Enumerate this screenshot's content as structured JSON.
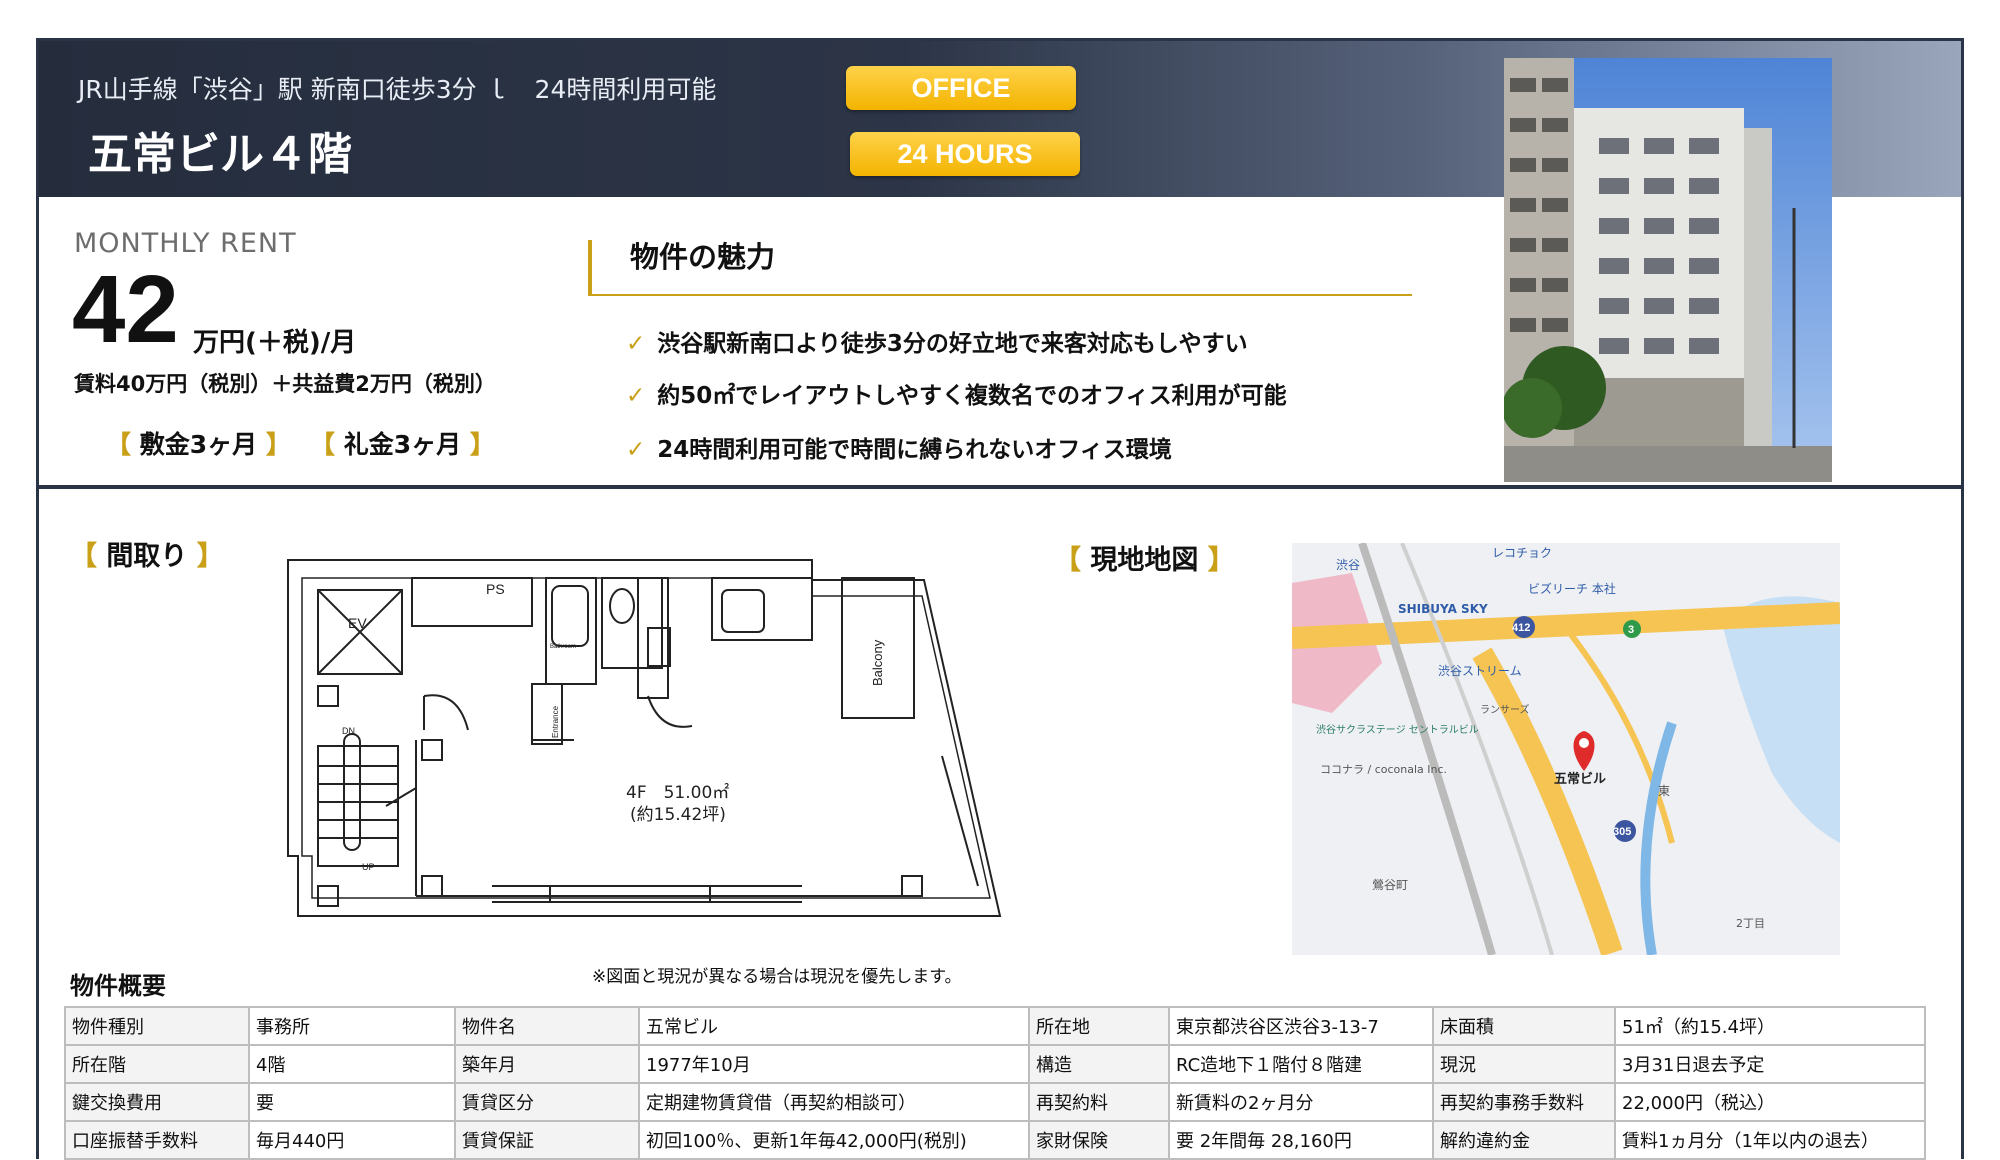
{
  "header": {
    "access": "JR山手線「渋谷」駅 新南口徒歩3分 ｌ　24時間利用可能",
    "title": "五常ビル４階",
    "badges": [
      "OFFICE",
      "24 HOURS"
    ]
  },
  "rent": {
    "label": "MONTHLY RENT",
    "amount": "42",
    "unit": "万円(＋税)/月",
    "detail": "賃料40万円（税別）＋共益費2万円（税別）",
    "deposit": "敷金3ヶ月",
    "key_money": "礼金3ヶ月"
  },
  "appeal": {
    "title": "物件の魅力",
    "items": [
      "渋谷駅新南口より徒歩3分の好立地で来客対応もしやすい",
      "約50㎡でレイアウトしやすく複数名でのオフィス利用が可能",
      "24時間利用可能で時間に縛られないオフィス環境"
    ]
  },
  "floorplan": {
    "title": "間取り",
    "labels": {
      "ps": "PS",
      "ev": "EV",
      "bathroom": "Bathroom",
      "balcony": "Balcony",
      "entrance": "Entrance",
      "dn": "DN",
      "up": "UP",
      "area": "4F　51.00㎡",
      "tsubo": "(約15.42坪)"
    },
    "note": "※図面と現況が異なる場合は現況を優先します。"
  },
  "map": {
    "title": "現地地図",
    "labels": [
      "レコチョク",
      "渋谷",
      "SHIBUYA SKY",
      "ビズリーチ 本社",
      "渋谷ストリーム",
      "ランサーズ",
      "渋谷サクラステージ セントラルビル",
      "ココナラ / coconala Inc.",
      "五常ビル",
      "鶯谷町",
      "東",
      "2丁目",
      "412",
      "305",
      "3"
    ]
  },
  "summary": {
    "title": "物件概要",
    "rows": [
      [
        "物件種別",
        "事務所",
        "物件名",
        "五常ビル",
        "所在地",
        "東京都渋谷区渋谷3-13-7",
        "床面積",
        "51㎡（約15.4坪）"
      ],
      [
        "所在階",
        "4階",
        "築年月",
        "1977年10月",
        "構造",
        "RC造地下１階付８階建",
        "現況",
        "3月31日退去予定"
      ],
      [
        "鍵交換費用",
        "要",
        "賃貸区分",
        "定期建物賃貸借（再契約相談可）",
        "再契約料",
        "新賃料の2ヶ月分",
        "再契約事務手数料",
        "22,000円（税込）"
      ],
      [
        "口座振替手数料",
        "毎月440円",
        "賃貸保証",
        "初回100％、更新1年毎42,000円(税別)",
        "家財保険",
        "要 2年間毎 28,160円",
        "解約違約金",
        "賃料1ヵ月分（1年以内の退去）"
      ]
    ]
  },
  "colors": {
    "navy": "#2b3447",
    "gold": "#c9a018",
    "badge": "#f3b400"
  }
}
